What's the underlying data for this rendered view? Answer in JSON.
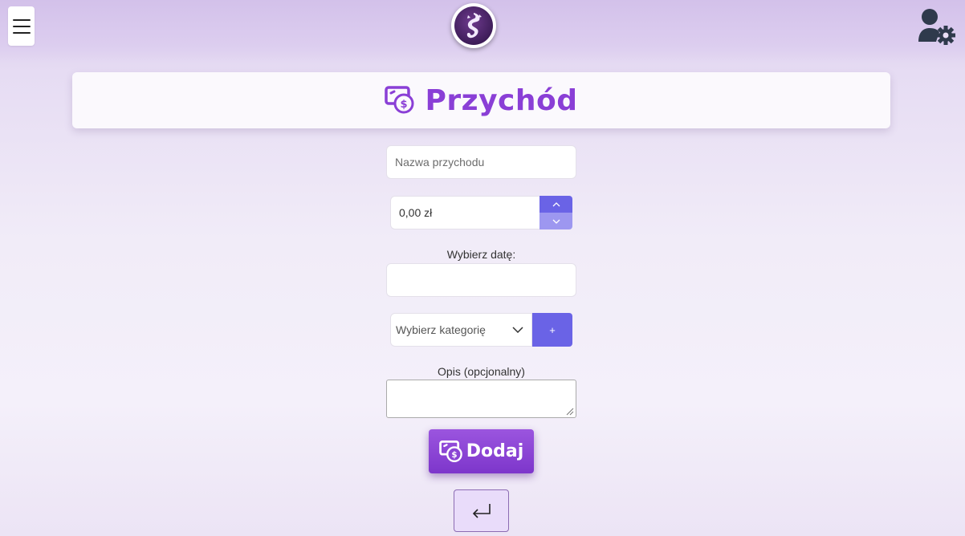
{
  "header": {
    "menu_icon": "hamburger-menu-icon",
    "logo_icon": "dragon-logo-icon",
    "user_icon": "user-settings-icon"
  },
  "title": {
    "icon": "money-income-icon",
    "text": "Przychód"
  },
  "form": {
    "name_placeholder": "Nazwa przychodu",
    "amount_value": "0,00 zł",
    "date_label": "Wybierz datę:",
    "category_value": "Wybierz kategorię",
    "add_category_label": "+",
    "description_label": "Opis (opcjonalny)",
    "submit_label": "Dodaj",
    "back_icon": "return-arrow-icon"
  },
  "colors": {
    "accent_purple": "#8a3fd6",
    "button_blue": "#6a63e6",
    "button_blue_light": "#9d97f0"
  }
}
